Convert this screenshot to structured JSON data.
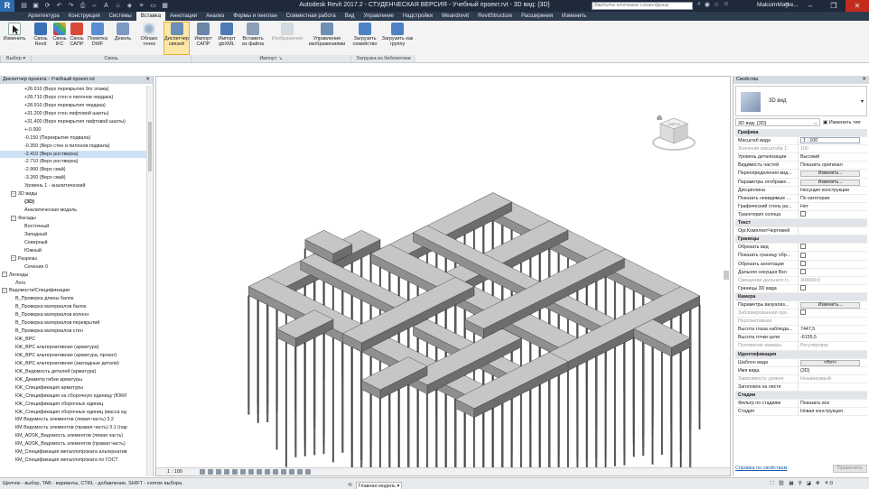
{
  "app": {
    "logo": "R",
    "window_title": "Autodesk Revit 2017.2 - СТУДЕНЧЕСКАЯ ВЕРСИЯ -   Учебный проект.rvt - 3D вид: {3D}",
    "search_placeholder": "Введите ключевое слово/фразу",
    "user": "MaksimMarke...",
    "help": "?"
  },
  "ribbon": {
    "tabs": [
      "Архитектура",
      "Конструкция",
      "Системы",
      "Вставка",
      "Аннотации",
      "Анализ",
      "Формы и генплан",
      "Совместная работа",
      "Вид",
      "Управление",
      "Надстройки",
      "Weandrevit",
      "RevitStructure",
      "Расширения",
      "Изменить"
    ],
    "active_tab": "Вставка",
    "buttons": [
      {
        "label": "Изменить",
        "icon": "cursor-icon"
      },
      {
        "label": "Связь Revit",
        "icon": "link-revit-icon"
      },
      {
        "label": "Связь IFC",
        "icon": "link-ifc-icon"
      },
      {
        "label": "Связь САПР",
        "icon": "link-cad-icon"
      },
      {
        "label": "Пометка DWF",
        "icon": "dwf-markup-icon"
      },
      {
        "label": "Деколь",
        "icon": "decal-icon"
      },
      {
        "label": "Облако точек",
        "icon": "point-cloud-icon"
      },
      {
        "label": "Диспетчер связей",
        "icon": "manage-links-icon"
      },
      {
        "label": "Импорт САПР",
        "icon": "import-cad-icon"
      },
      {
        "label": "Импорт gbXML",
        "icon": "import-gbxml-icon"
      },
      {
        "label": "Вставить из файла",
        "icon": "insert-from-file-icon"
      },
      {
        "label": "Изображение",
        "icon": "image-icon"
      },
      {
        "label": "Управление изображениями",
        "icon": "manage-images-icon"
      },
      {
        "label": "Загрузить семейство",
        "icon": "load-family-icon"
      },
      {
        "label": "Загрузить как группу",
        "icon": "load-group-icon"
      }
    ],
    "groups": [
      "Выбор",
      "Связь",
      "Импорт",
      "Загрузка из библиотеки"
    ]
  },
  "project_browser": {
    "title": "Диспетчер проекта - Учебный проект.rvt",
    "rows": [
      {
        "text": "+26.910 (Верх перекрытия 9го этажа)",
        "indent": 5
      },
      {
        "text": "+28.710 (Верх стен и пилонов чердака)",
        "indent": 5
      },
      {
        "text": "+28.910 (Верх перекрытия чердака)",
        "indent": 5
      },
      {
        "text": "+31.200 (Верх стен лифтовой шахты)",
        "indent": 5
      },
      {
        "text": "+31.400 (Верх перекрытия лифтовой шахты)",
        "indent": 5
      },
      {
        "text": "+-0.000",
        "indent": 5
      },
      {
        "text": "-0.150 (Перекрытие подвала)",
        "indent": 5
      },
      {
        "text": "-0.350 (Верх стен и пилонов подвала)",
        "indent": 5
      },
      {
        "text": "-2.410 (Верх ростверка)",
        "indent": 5,
        "selected": true
      },
      {
        "text": "-2.710 (Верх ростверка)",
        "indent": 5
      },
      {
        "text": "-2.960 (Верх свай)",
        "indent": 5
      },
      {
        "text": "-3.260 (Верх свай)",
        "indent": 5
      },
      {
        "text": "Уровень 1 - аналитический",
        "indent": 5
      },
      {
        "text": "3D виды",
        "indent": 2,
        "toggle": "−"
      },
      {
        "text": "{3D}",
        "indent": 5,
        "bold": true
      },
      {
        "text": "Аналитическая модель",
        "indent": 5
      },
      {
        "text": "Фасады",
        "indent": 2,
        "toggle": "−"
      },
      {
        "text": "Восточный",
        "indent": 5
      },
      {
        "text": "Западный",
        "indent": 5
      },
      {
        "text": "Северный",
        "indent": 5
      },
      {
        "text": "Южный",
        "indent": 5
      },
      {
        "text": "Разрезы",
        "indent": 2,
        "toggle": "−"
      },
      {
        "text": "Сечение 0",
        "indent": 5
      },
      {
        "text": "Легенды",
        "indent": 0,
        "toggle": "−"
      },
      {
        "text": "Лого",
        "indent": 3
      },
      {
        "text": "Ведомости/Спецификации",
        "indent": 0,
        "toggle": "−"
      },
      {
        "text": "В_Проверка длины балок",
        "indent": 3
      },
      {
        "text": "В_Проверка материалов балок",
        "indent": 3
      },
      {
        "text": "В_Проверка материалов колонн",
        "indent": 3
      },
      {
        "text": "В_Проверка материалов перекрытий",
        "indent": 3
      },
      {
        "text": "В_Проверка материалов стен",
        "indent": 3
      },
      {
        "text": "КЖ_ВРС",
        "indent": 3
      },
      {
        "text": "КЖ_ВРС альтернативная (арматура)",
        "indent": 3
      },
      {
        "text": "КЖ_ВРС альтернативная (арматура, прокат)",
        "indent": 3
      },
      {
        "text": "КЖ_ВРС альтернативная (закладные детали)",
        "indent": 3
      },
      {
        "text": "КЖ_Ведомость деталей (арматура)",
        "indent": 3
      },
      {
        "text": "КЖ_Диаметр гибки арматуры",
        "indent": 3
      },
      {
        "text": "КЖ_Спецификация арматуры",
        "indent": 3
      },
      {
        "text": "КЖ_Спецификация на сборочную единицу (ЮКИ",
        "indent": 3
      },
      {
        "text": "КЖ_Спецификация сборочных единиц",
        "indent": 3
      },
      {
        "text": "КЖ_Спецификация сборочных единиц (масса ед",
        "indent": 3
      },
      {
        "text": "КМ Ведомость элементов (левая часть) 3.2",
        "indent": 3
      },
      {
        "text": "КМ Ведомость элементов (правая часть) 3.1 (пар",
        "indent": 3
      },
      {
        "text": "КМ_ADSK_Ведомость элементов (левая часть)",
        "indent": 3
      },
      {
        "text": "КМ_ADSK_Ведомость элементов (правая часть)",
        "indent": 3
      },
      {
        "text": "КМ_Спецификация металлопроката альтернатив",
        "indent": 3
      },
      {
        "text": "КМ_Спецификация металлопроката по ГОСТ",
        "indent": 3
      }
    ]
  },
  "viewport": {
    "scale": "1 : 100"
  },
  "view_cube": {
    "front_label": "СВЕРХУ"
  },
  "properties": {
    "title": "Свойства",
    "type_name": "3D вид",
    "instance_selector": "3D вид: {3D}",
    "edit_type_btn": "Изменить тип",
    "rows": [
      {
        "cat": "Графика"
      },
      {
        "k": "Масштаб вида",
        "v": "1 : 100",
        "kind": "input"
      },
      {
        "k": "Значение масштаба   1:",
        "v": "100",
        "dim": true
      },
      {
        "k": "Уровень детализации",
        "v": "Высокий"
      },
      {
        "k": "Видимость частей",
        "v": "Показать оригинал"
      },
      {
        "k": "Переопределения вид...",
        "v": "Изменить...",
        "kind": "button"
      },
      {
        "k": "Параметры отображе...",
        "v": "Изменить...",
        "kind": "button"
      },
      {
        "k": "Дисциплина",
        "v": "Несущие конструкции"
      },
      {
        "k": "Показать невидимые ...",
        "v": "По категории"
      },
      {
        "k": "Графический стиль ра...",
        "v": "Нет"
      },
      {
        "k": "Траектория солнца",
        "v": "",
        "kind": "check"
      },
      {
        "cat": "Текст"
      },
      {
        "k": "Орг.КомплектЧертежей",
        "v": ""
      },
      {
        "cat": "Границы"
      },
      {
        "k": "Обрезать вид",
        "v": "",
        "kind": "check"
      },
      {
        "k": "Показать границу обр...",
        "v": "",
        "kind": "check"
      },
      {
        "k": "Обрезать аннотации",
        "v": "",
        "kind": "check"
      },
      {
        "k": "Дальняя секущая Вкл",
        "v": "",
        "kind": "check"
      },
      {
        "k": "Смещение дальнего п...",
        "v": "304800.0",
        "dim": true
      },
      {
        "k": "Границы 3D вида",
        "v": "",
        "kind": "check"
      },
      {
        "cat": "Камера"
      },
      {
        "k": "Параметры визуализ...",
        "v": "Изменить...",
        "kind": "button"
      },
      {
        "k": "Заблокированная ори...",
        "v": "",
        "kind": "check",
        "dim": true
      },
      {
        "k": "Перспективная",
        "v": "",
        "dim": true
      },
      {
        "k": "Высота глаза наблюда...",
        "v": "7447,5"
      },
      {
        "k": "Высота точки цели",
        "v": "-6155,5"
      },
      {
        "k": "Положение камеры",
        "v": "Регулировка",
        "dim": true
      },
      {
        "cat": "Идентификация"
      },
      {
        "k": "Шаблон вида",
        "v": "<Нет>",
        "kind": "button"
      },
      {
        "k": "Имя вида",
        "v": "{3D}"
      },
      {
        "k": "Зависимость уровня",
        "v": "Независимый",
        "dim": true
      },
      {
        "k": "Заголовок на листе",
        "v": ""
      },
      {
        "cat": "Стадии"
      },
      {
        "k": "Фильтр по стадиям",
        "v": "Показать все"
      },
      {
        "k": "Стадия",
        "v": "Новая конструкция"
      }
    ],
    "help_link": "Справка по свойствам",
    "apply_btn": "Применить"
  },
  "status": {
    "text": "Щелчок - выбор, TAB - варианты, CTRL - добавление, SHIFT - снятие выбора.",
    "model": "Главная модель",
    "filter_count": ":0"
  }
}
